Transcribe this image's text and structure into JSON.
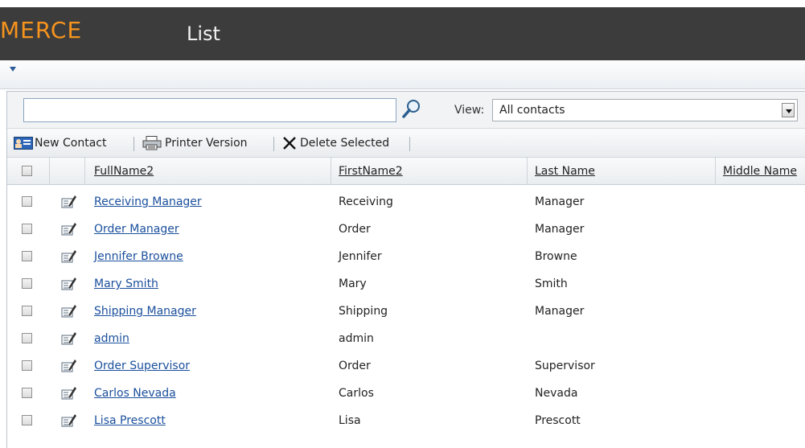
{
  "header": {
    "brand": "MERCE",
    "title": "List"
  },
  "search": {
    "value": "",
    "placeholder": ""
  },
  "view": {
    "label": "View:",
    "selected": "All contacts"
  },
  "toolbar": {
    "new_contact": "New Contact",
    "printer_version": "Printer Version",
    "delete_selected": "Delete Selected"
  },
  "columns": [
    "FullName2",
    "FirstName2",
    "Last Name",
    "Middle Name"
  ],
  "rows": [
    {
      "full": "Receiving Manager",
      "first": "Receiving",
      "last": "Manager"
    },
    {
      "full": "Order Manager",
      "first": "Order",
      "last": "Manager"
    },
    {
      "full": "Jennifer Browne",
      "first": "Jennifer",
      "last": "Browne"
    },
    {
      "full": "Mary Smith",
      "first": "Mary",
      "last": "Smith"
    },
    {
      "full": "Shipping Manager",
      "first": "Shipping",
      "last": "Manager"
    },
    {
      "full": "admin",
      "first": "admin",
      "last": ""
    },
    {
      "full": "Order Supervisor",
      "first": "Order",
      "last": "Supervisor"
    },
    {
      "full": "Carlos Nevada",
      "first": "Carlos",
      "last": "Nevada"
    },
    {
      "full": "Lisa Prescott",
      "first": "Lisa",
      "last": "Prescott"
    }
  ],
  "icons": {
    "search": "magnifier-icon",
    "new_contact": "contact-card-icon",
    "printer": "printer-icon",
    "delete": "x-icon",
    "edit": "edit-record-icon",
    "subbar": "dropdown-arrow-icon"
  },
  "colors": {
    "brand": "#f7941d",
    "header_bg": "#3c3c3c",
    "link": "#1a4f9c"
  }
}
